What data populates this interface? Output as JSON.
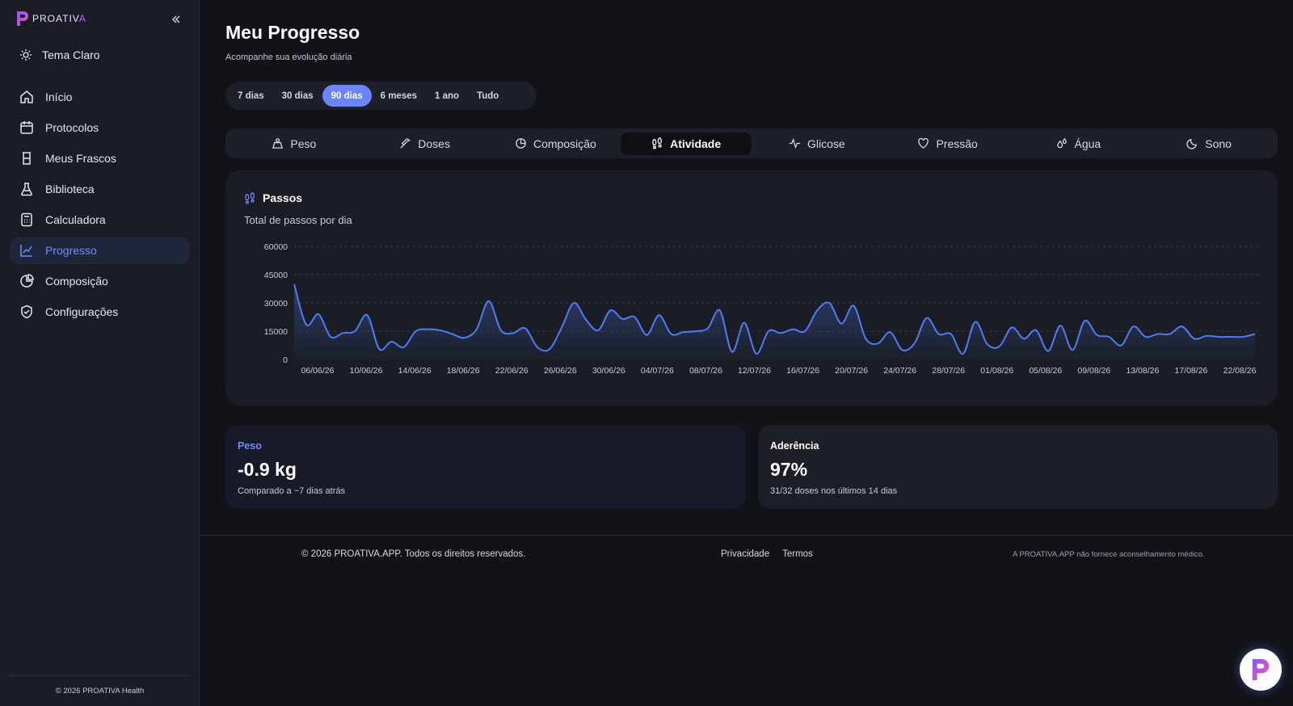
{
  "app": {
    "logo_text_main": "PROATIV",
    "logo_text_accent": "A",
    "logo_letter": "P"
  },
  "sidebar": {
    "theme_label": "Tema Claro",
    "items": [
      {
        "label": "Início",
        "icon": "home-icon"
      },
      {
        "label": "Protocolos",
        "icon": "calendar-icon"
      },
      {
        "label": "Meus Frascos",
        "icon": "vial-icon"
      },
      {
        "label": "Biblioteca",
        "icon": "flask-icon"
      },
      {
        "label": "Calculadora",
        "icon": "calculator-icon"
      },
      {
        "label": "Progresso",
        "icon": "chart-line-icon",
        "active": true
      },
      {
        "label": "Composição",
        "icon": "pie-chart-icon"
      },
      {
        "label": "Configurações",
        "icon": "shield-check-icon"
      }
    ],
    "footer": "© 2026 PROATIVA Health"
  },
  "header": {
    "title": "Meu Progresso",
    "subtitle": "Acompanhe sua evolução diária"
  },
  "ranges": [
    {
      "label": "7 dias"
    },
    {
      "label": "30 dias"
    },
    {
      "label": "90 dias",
      "active": true
    },
    {
      "label": "6 meses"
    },
    {
      "label": "1 ano"
    },
    {
      "label": "Tudo"
    }
  ],
  "tabs": [
    {
      "label": "Peso",
      "icon": "weight-icon"
    },
    {
      "label": "Doses",
      "icon": "syringe-icon"
    },
    {
      "label": "Composição",
      "icon": "pie-chart-icon"
    },
    {
      "label": "Atividade",
      "icon": "footprints-icon",
      "active": true
    },
    {
      "label": "Glicose",
      "icon": "activity-icon"
    },
    {
      "label": "Pressão",
      "icon": "heart-icon"
    },
    {
      "label": "Água",
      "icon": "droplets-icon"
    },
    {
      "label": "Sono",
      "icon": "moon-icon"
    }
  ],
  "chart_card": {
    "title": "Passos",
    "subtitle": "Total de passos por dia"
  },
  "chart_data": {
    "type": "area",
    "title": "Passos",
    "subtitle": "Total de passos por dia",
    "ylim": [
      0,
      60000
    ],
    "yticks": [
      0,
      15000,
      30000,
      45000,
      60000
    ],
    "xtick_labels": [
      "06/06/26",
      "10/06/26",
      "14/06/26",
      "18/06/26",
      "22/06/26",
      "26/06/26",
      "30/06/26",
      "04/07/26",
      "08/07/26",
      "12/07/26",
      "16/07/26",
      "20/07/26",
      "24/07/26",
      "28/07/26",
      "01/08/26",
      "05/08/26",
      "09/08/26",
      "13/08/26",
      "17/08/26",
      "22/08/26"
    ],
    "grid": true,
    "color": "#4f7bf5",
    "series": [
      {
        "values": [
          40000,
          18500,
          24000,
          12000,
          14000,
          15000,
          23500,
          5500,
          9500,
          6500,
          15000,
          16000,
          15500,
          13500,
          11500,
          16000,
          31000,
          15500,
          14000,
          16500,
          6500,
          5500,
          17000,
          30000,
          21000,
          15500,
          26000,
          21500,
          22500,
          13000,
          23500,
          13500,
          14500,
          15000,
          16500,
          26000,
          4000,
          19500,
          3000,
          15000,
          14000,
          16000,
          15000,
          26000,
          30000,
          19000,
          28500,
          11000,
          8500,
          14500,
          5000,
          8500,
          22000,
          13500,
          13500,
          3000,
          20000,
          8000,
          7000,
          17000,
          11000,
          15500,
          4500,
          18000,
          5000,
          20500,
          13000,
          12000,
          7500,
          17500,
          12000,
          13500,
          13500,
          17500,
          11000,
          12500,
          12000,
          12000,
          12000,
          13500
        ]
      }
    ]
  },
  "stats": {
    "weight": {
      "label": "Peso",
      "value": "-0.9 kg",
      "note": "Comparado a ~7 dias atrás"
    },
    "adherence": {
      "label": "Aderência",
      "value": "97%",
      "note": "31/32 doses nos últimos 14 dias"
    }
  },
  "footer": {
    "copyright": "© 2026 PROATIVA.APP. Todos os direitos reservados.",
    "privacy": "Privacidade",
    "terms": "Termos",
    "disclaimer": "A PROATIVA.APP não fornece aconselhamento médico."
  }
}
